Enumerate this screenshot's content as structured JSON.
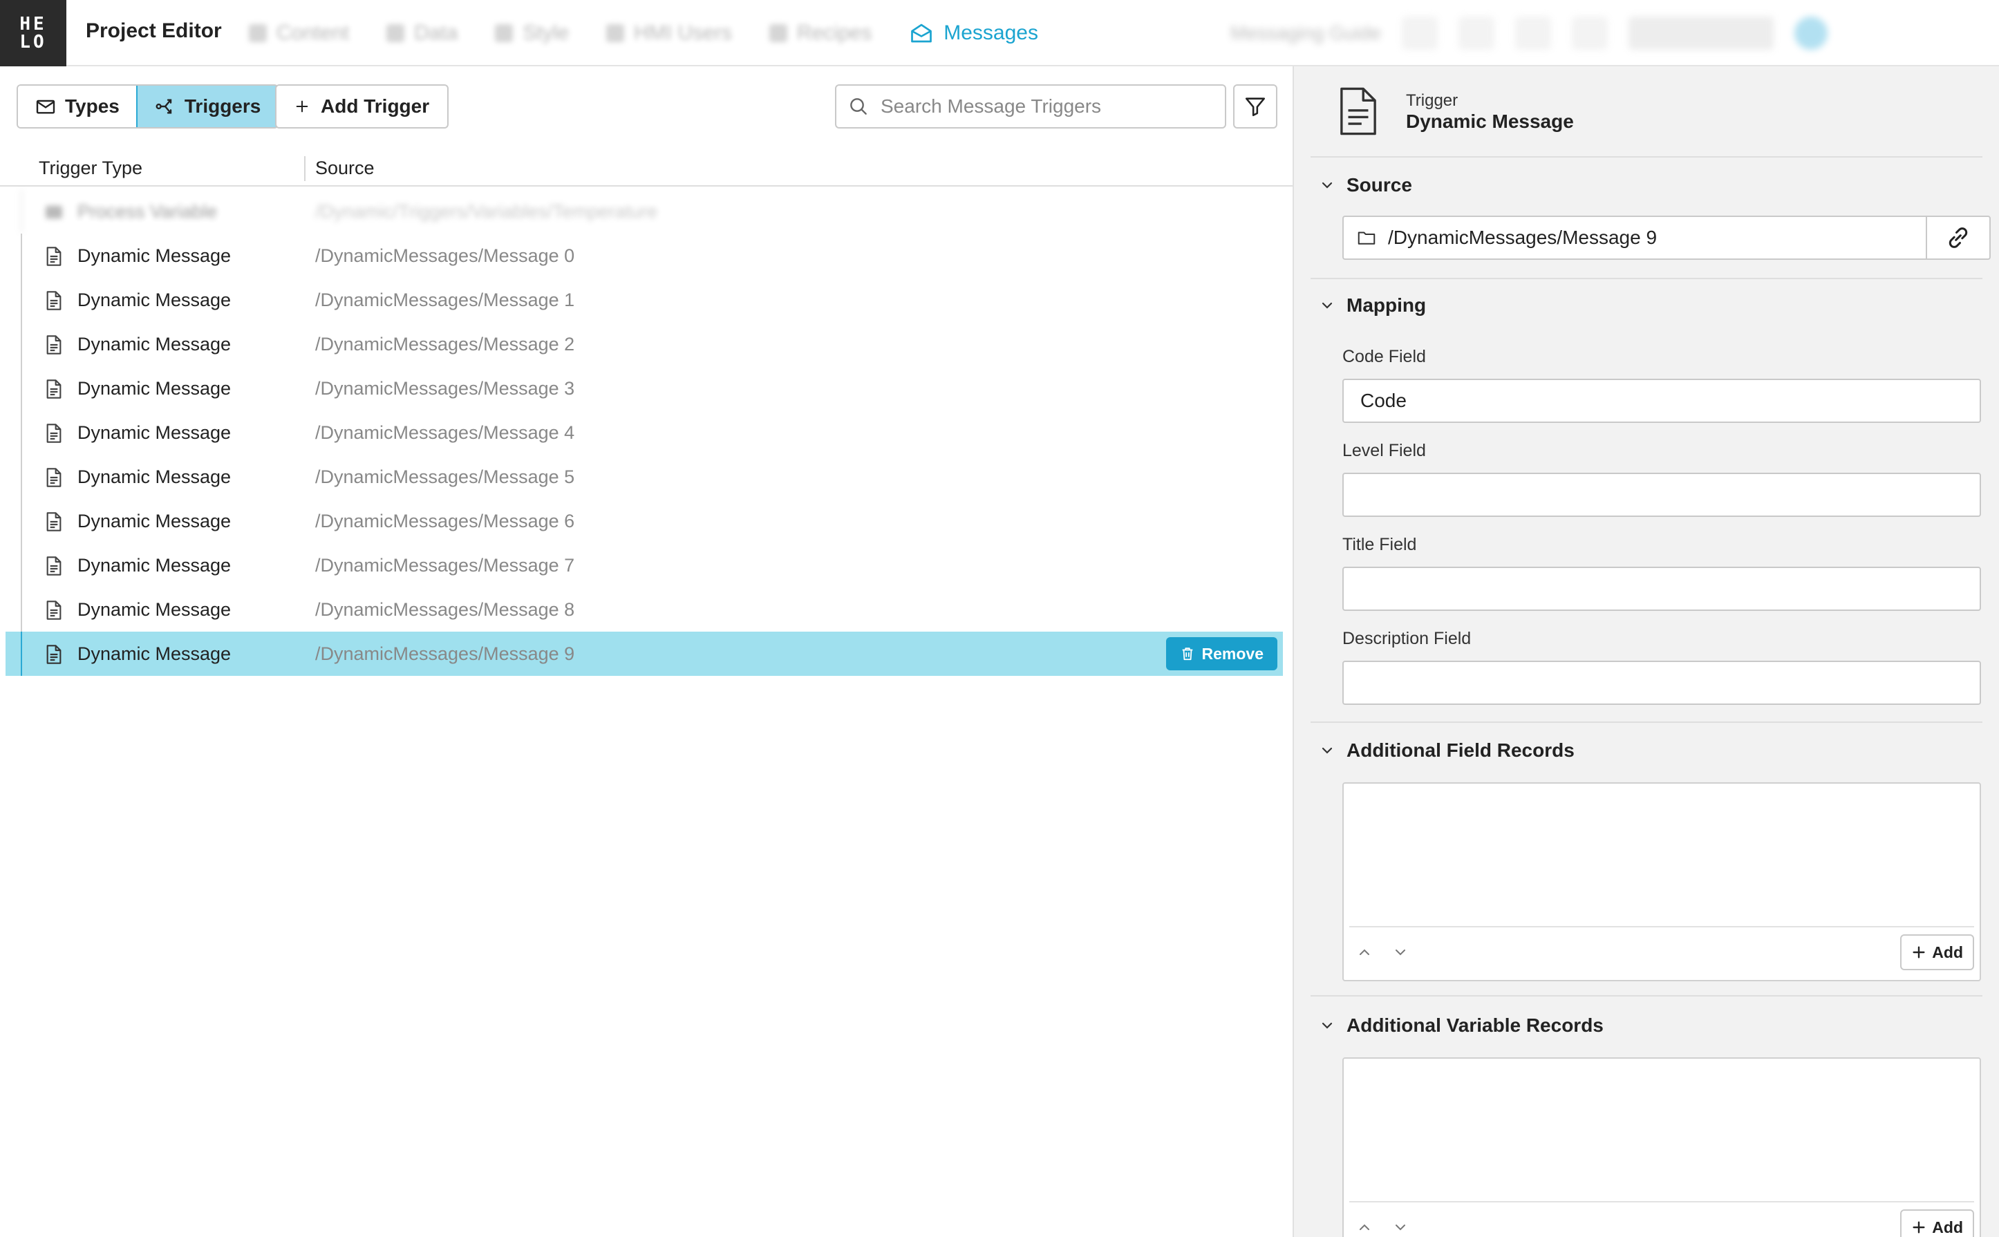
{
  "header": {
    "logo_top": "HE",
    "logo_bottom": "LO",
    "title": "Project Editor",
    "nav": [
      {
        "label": "Content",
        "icon": "content-icon"
      },
      {
        "label": "Data",
        "icon": "data-icon"
      },
      {
        "label": "Style",
        "icon": "style-icon"
      },
      {
        "label": "HMI Users",
        "icon": "users-icon"
      },
      {
        "label": "Recipes",
        "icon": "recipes-icon"
      },
      {
        "label": "Messages",
        "icon": "envelope-open-icon",
        "active": true
      }
    ],
    "guide": "Messaging Guide"
  },
  "toolbar": {
    "types_label": "Types",
    "triggers_label": "Triggers",
    "add_trigger_label": "Add Trigger",
    "search_placeholder": "Search Message Triggers"
  },
  "table": {
    "col_type": "Trigger Type",
    "col_source": "Source",
    "blurred_row": {
      "type": "Process Variable",
      "source": "/Dynamic/Triggers/Variables/Temperature"
    },
    "rows": [
      {
        "type": "Dynamic Message",
        "source": "/DynamicMessages/Message 0"
      },
      {
        "type": "Dynamic Message",
        "source": "/DynamicMessages/Message 1"
      },
      {
        "type": "Dynamic Message",
        "source": "/DynamicMessages/Message 2"
      },
      {
        "type": "Dynamic Message",
        "source": "/DynamicMessages/Message 3"
      },
      {
        "type": "Dynamic Message",
        "source": "/DynamicMessages/Message 4"
      },
      {
        "type": "Dynamic Message",
        "source": "/DynamicMessages/Message 5"
      },
      {
        "type": "Dynamic Message",
        "source": "/DynamicMessages/Message 6"
      },
      {
        "type": "Dynamic Message",
        "source": "/DynamicMessages/Message 7"
      },
      {
        "type": "Dynamic Message",
        "source": "/DynamicMessages/Message 8"
      },
      {
        "type": "Dynamic Message",
        "source": "/DynamicMessages/Message 9",
        "selected": true
      }
    ],
    "remove_label": "Remove"
  },
  "detail": {
    "kind_label": "Trigger",
    "kind_name": "Dynamic Message",
    "source_section": "Source",
    "source_value": "/DynamicMessages/Message 9",
    "mapping_section": "Mapping",
    "code_label": "Code Field",
    "code_value": "Code",
    "level_label": "Level Field",
    "level_value": "",
    "title_label": "Title Field",
    "title_value": "",
    "description_label": "Description Field",
    "description_value": "",
    "field_records_section": "Additional Field Records",
    "variable_records_section": "Additional Variable Records",
    "add_label": "Add"
  },
  "colors": {
    "accent": "#1ba4d0",
    "selected_row": "#9fe0ee",
    "remove_button": "#1a9fcc",
    "logo_bg": "#2b2b2b"
  }
}
